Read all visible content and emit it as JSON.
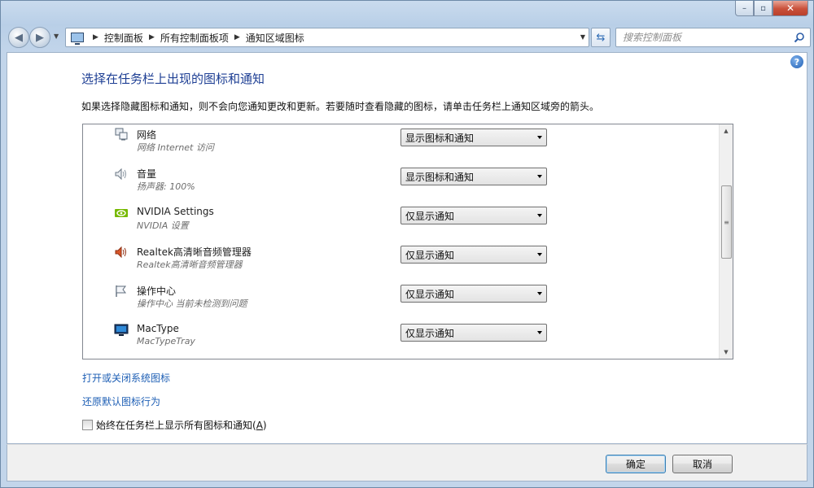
{
  "window": {
    "ghost_title": "",
    "controls": {
      "minimize": "–",
      "restore": "▫",
      "close": "✕"
    }
  },
  "nav": {
    "back_glyph": "◀",
    "forward_glyph": "▶",
    "breadcrumbs": [
      "控制面板",
      "所有控制面板项",
      "通知区域图标"
    ],
    "search_placeholder": "搜索控制面板"
  },
  "page": {
    "title": "选择在任务栏上出现的图标和通知",
    "intro": "如果选择隐藏图标和通知，则不会向您通知更改和更新。若要随时查看隐藏的图标，请单击任务栏上通知区域旁的箭头。",
    "help_glyph": "?"
  },
  "items": [
    {
      "name": "网络",
      "sub": "网络 Internet 访问",
      "behavior": "显示图标和通知",
      "icon": "network-icon"
    },
    {
      "name": "音量",
      "sub": "扬声器: 100%",
      "behavior": "显示图标和通知",
      "icon": "speaker-icon"
    },
    {
      "name": "NVIDIA Settings",
      "sub": "NVIDIA 设置",
      "behavior": "仅显示通知",
      "icon": "nvidia-icon"
    },
    {
      "name": "Realtek高清晰音频管理器",
      "sub": "Realtek高清晰音频管理器",
      "behavior": "仅显示通知",
      "icon": "realtek-speaker-icon"
    },
    {
      "name": "操作中心",
      "sub": "操作中心  当前未检测到问题",
      "behavior": "仅显示通知",
      "icon": "flag-icon"
    },
    {
      "name": "MacType",
      "sub": "MacTypeTray",
      "behavior": "仅显示通知",
      "icon": "monitor-icon"
    }
  ],
  "links": {
    "system_icons": "打开或关闭系统图标",
    "restore_defaults": "还原默认图标行为"
  },
  "always_show": {
    "label": "始终在任务栏上显示所有图标和通知(",
    "accel": "A",
    "label_end": ")",
    "checked": false
  },
  "buttons": {
    "ok": "确定",
    "cancel": "取消"
  },
  "colors": {
    "title": "#1e3f94",
    "link": "#1e5fb5",
    "close": "#c9503a"
  }
}
